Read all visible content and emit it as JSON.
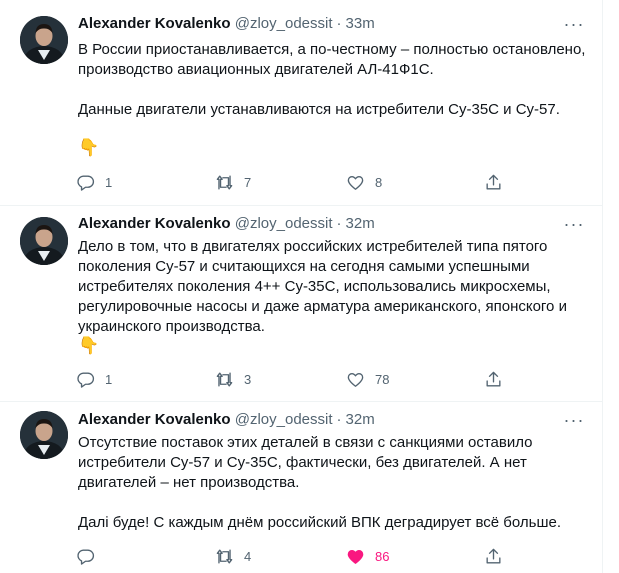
{
  "colors": {
    "text": "#0f1419",
    "secondary": "#536471",
    "like_active": "#f91880",
    "divider": "#eff3f4"
  },
  "tweets": [
    {
      "author": "Alexander Kovalenko",
      "handle": "@zloy_odessit",
      "separator": "·",
      "time": "33m",
      "text": "В России приостанавливается, а по-честному – полностью остановлено,\nпроизводство авиационных двигателей АЛ-41Ф1С.\n\nДанные двигатели устанавливаются на истребители Су-35С и Су-57.",
      "emoji": "👇",
      "replies": "1",
      "retweets": "7",
      "likes": "8",
      "liked": false
    },
    {
      "author": "Alexander Kovalenko",
      "handle": "@zloy_odessit",
      "separator": "·",
      "time": "32m",
      "text": "Дело в том, что в двигателях российских истребителей типа пятого\nпоколения Су-57 и считающихся на сегодня самыми успешными\nистребителях поколения 4++ Су-35С, использовались микросхемы,\nрегулировочные насосы и даже арматура американского, японского и\nукраинского производства.",
      "emoji": "👇",
      "replies": "1",
      "retweets": "3",
      "likes": "78",
      "liked": false
    },
    {
      "author": "Alexander Kovalenko",
      "handle": "@zloy_odessit",
      "separator": "·",
      "time": "32m",
      "text": "Отсутствие поставок этих деталей в связи с санкциями оставило\nистребители Су-57 и Су-35С, фактически, без двигателей. А нет\nдвигателей – нет производства.\n\nДалі буде! С каждым днём российский ВПК деградирует всё больше.",
      "replies": "",
      "retweets": "4",
      "likes": "86",
      "liked": true
    }
  ],
  "icons": {
    "reply": "reply-icon",
    "retweet": "retweet-icon",
    "like": "heart-icon",
    "share": "share-icon",
    "more": "more-options-icon"
  }
}
